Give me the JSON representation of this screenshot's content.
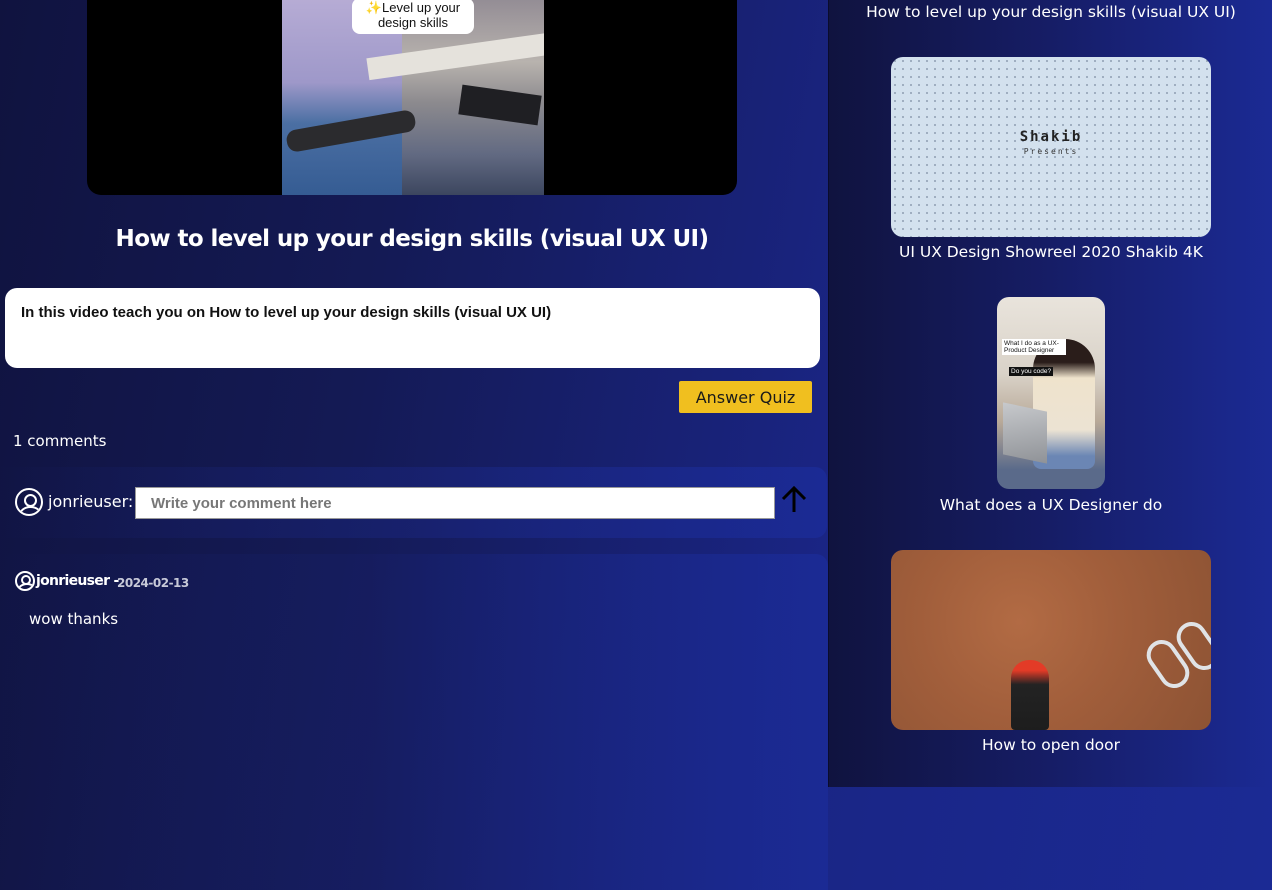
{
  "video": {
    "overlay_text": "✨Level up your design skills",
    "title": "How to level up your design skills (visual UX UI)",
    "description": "In this video teach you on How to level up your design skills (visual UX UI)"
  },
  "quiz": {
    "button_label": "Answer Quiz"
  },
  "comments": {
    "count_label": "1 comments",
    "form": {
      "username_label": "jonrieuser:",
      "placeholder": "Write your comment here"
    },
    "items": [
      {
        "author": "jonrieuser -",
        "date": "2024-02-13",
        "text": "wow thanks"
      }
    ]
  },
  "sidebar": {
    "current_title": "How to level up your design skills (visual UX UI)",
    "videos": [
      {
        "title": "UI UX Design Showreel 2020 Shakib 4K",
        "thumb_brand": "Shakib",
        "thumb_sub": "Presents"
      },
      {
        "title": "What does a UX Designer do",
        "thumb_label_1": "What I do as a UX-Product Designer",
        "thumb_label_2": "Do you code?"
      },
      {
        "title": "How to open door"
      }
    ]
  },
  "colors": {
    "accent_button": "#f0bf1f",
    "background_dark": "#10133f",
    "background_blue": "#1b2a94"
  },
  "icons": {
    "user": "user-circle-icon",
    "send": "arrow-up-icon"
  }
}
